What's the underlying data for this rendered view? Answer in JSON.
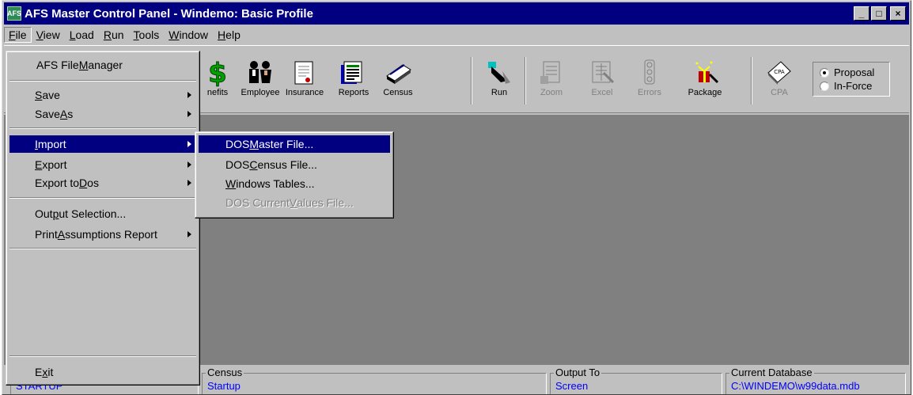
{
  "window": {
    "title": "AFS Master Control Panel - Windemo: Basic Profile",
    "app_icon_text": "AFS",
    "minimize": "_",
    "maximize": "□",
    "close": "×"
  },
  "menubar": {
    "items": [
      {
        "pre": "",
        "key": "F",
        "post": "ile"
      },
      {
        "pre": "",
        "key": "V",
        "post": "iew"
      },
      {
        "pre": "",
        "key": "L",
        "post": "oad"
      },
      {
        "pre": "",
        "key": "R",
        "post": "un"
      },
      {
        "pre": "",
        "key": "T",
        "post": "ools"
      },
      {
        "pre": "",
        "key": "W",
        "post": "indow"
      },
      {
        "pre": "",
        "key": "H",
        "post": "elp"
      }
    ]
  },
  "toolbar": {
    "tools": [
      {
        "label": "nefits",
        "icon": "benefits-icon"
      },
      {
        "label": "Employee",
        "icon": "employee-icon"
      },
      {
        "label": "Insurance",
        "icon": "insurance-icon"
      },
      {
        "label": "Reports",
        "icon": "reports-icon"
      },
      {
        "label": "Census",
        "icon": "census-icon"
      },
      {
        "label": "Run",
        "icon": "run-icon"
      },
      {
        "label": "Zoom",
        "icon": "zoom-icon"
      },
      {
        "label": "Excel",
        "icon": "excel-icon"
      },
      {
        "label": "Errors",
        "icon": "errors-icon"
      },
      {
        "label": "Package",
        "icon": "package-icon"
      },
      {
        "label": "CPA",
        "icon": "cpa-icon"
      }
    ],
    "mode": {
      "options": [
        "Proposal",
        "In-Force"
      ],
      "selected": "Proposal"
    }
  },
  "file_menu": {
    "file_manager": {
      "pre": "AFS File ",
      "key": "M",
      "post": "anager"
    },
    "save": {
      "pre": "",
      "key": "S",
      "post": "ave"
    },
    "save_as": {
      "pre": "Save ",
      "key": "A",
      "post": "s"
    },
    "import": {
      "pre": "",
      "key": "I",
      "post": "mport"
    },
    "export": {
      "pre": "",
      "key": "E",
      "post": "xport"
    },
    "export_dos": {
      "pre": "Export to ",
      "key": "D",
      "post": "os"
    },
    "output_selection": {
      "pre": "Out",
      "key": "p",
      "post": "ut Selection..."
    },
    "print_assumptions": {
      "pre": "Print ",
      "key": "A",
      "post": "ssumptions Report"
    },
    "exit": {
      "pre": "E",
      "key": "x",
      "post": "it"
    }
  },
  "import_submenu": {
    "dos_master": {
      "pre": "DOS ",
      "key": "M",
      "post": "aster File..."
    },
    "dos_census": {
      "pre": "DOS ",
      "key": "C",
      "post": "ensus File..."
    },
    "windows_tables": {
      "pre": "",
      "key": "W",
      "post": "indows Tables..."
    },
    "dos_current_values": {
      "pre": "DOS Current ",
      "key": "V",
      "post": "alues File..."
    }
  },
  "statusbar": {
    "group1_value": "STARTUP",
    "census_label": "Census",
    "census_value": "Startup",
    "output_label": "Output To",
    "output_value": "Screen",
    "database_label": "Current Database",
    "database_value": "C:\\WINDEMO\\w99data.mdb"
  },
  "colors": {
    "titlebar": "#000080",
    "face": "#c0c0c0",
    "client": "#808080",
    "highlight": "#000080",
    "status_value": "#0000ff"
  }
}
